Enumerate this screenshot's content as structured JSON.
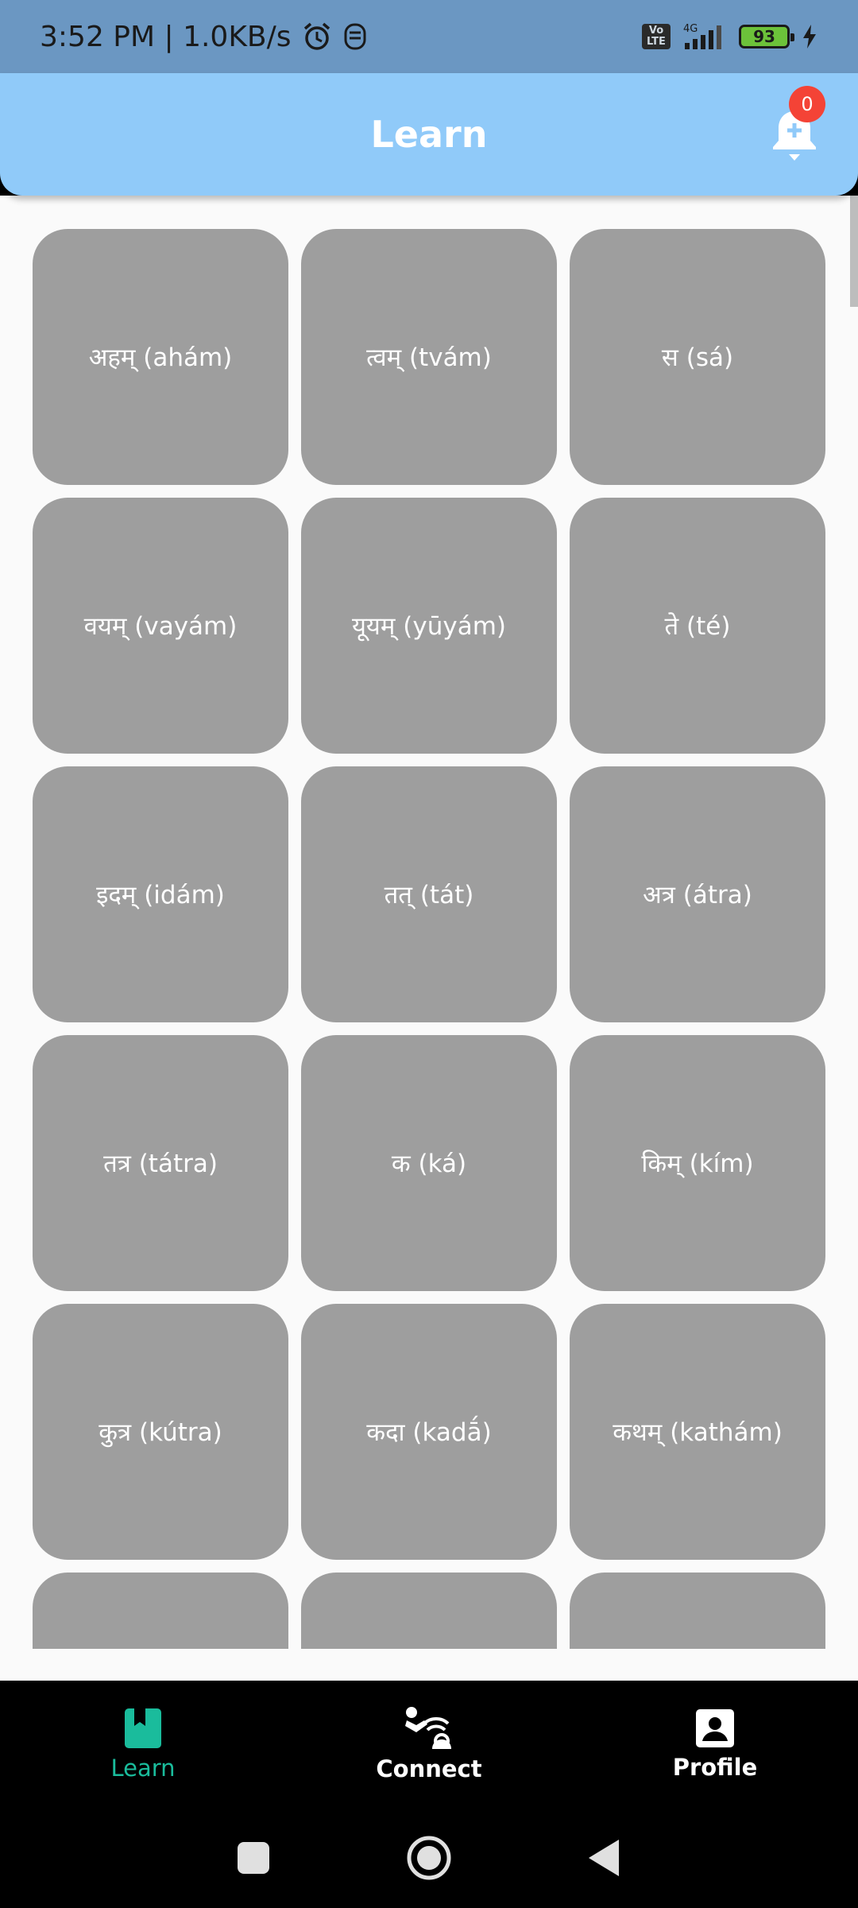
{
  "status_bar": {
    "time_speed": "3:52 PM | 1.0KB/s",
    "volte": "Vo LTE",
    "network": "4G",
    "battery": "93"
  },
  "app_bar": {
    "title": "Learn",
    "notification_count": "0"
  },
  "words": [
    "अहम् (ahám)",
    "त्वम् (tvám)",
    "स (sá)",
    "वयम् (vayám)",
    "यूयम् (yūyám)",
    "ते (té)",
    "इदम् (idám)",
    "तत् (tát)",
    "अत्र (átra)",
    "तत्र (tátra)",
    "क (ká)",
    "किम् (kím)",
    "कुत्र (kútra)",
    "कदा (kadā́)",
    "कथम् (kathám)",
    "",
    "",
    ""
  ],
  "bottom_nav": {
    "learn": "Learn",
    "connect": "Connect",
    "profile": "Profile"
  },
  "colors": {
    "status_bar": "#6b97c2",
    "app_bar": "#90caf9",
    "tile": "#9e9e9e",
    "active_nav": "#1abc9c",
    "badge": "#f44336"
  }
}
